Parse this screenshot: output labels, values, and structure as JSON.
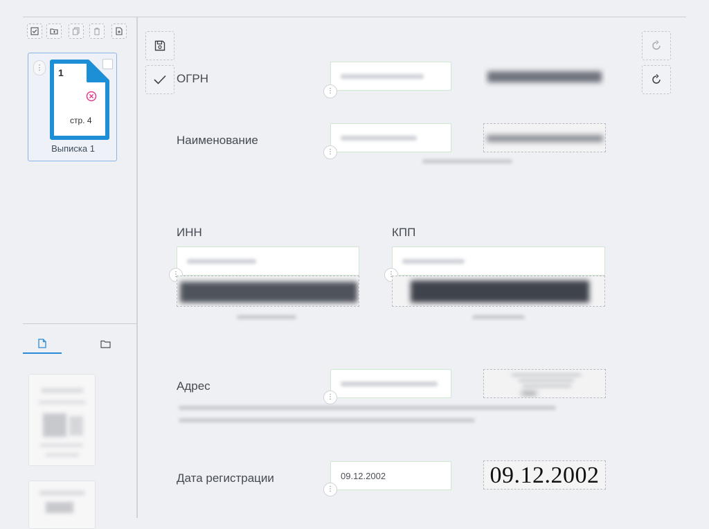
{
  "toolbar": {
    "icons": [
      "check-square-icon",
      "folder-icon",
      "copy-icon",
      "trash-icon",
      "file-add-icon"
    ]
  },
  "document_card": {
    "number": "1",
    "page": "стр. 4",
    "label": "Выписка 1",
    "status_color": "#e53a8c",
    "accent_color": "#1d8fd6"
  },
  "left_tabs": [
    "file-icon",
    "folder-icon"
  ],
  "form": {
    "fields": {
      "ogrn": {
        "label": "ОГРН"
      },
      "name": {
        "label": "Наименование"
      },
      "inn": {
        "label": "ИНН"
      },
      "kpp": {
        "label": "КПП"
      },
      "address": {
        "label": "Адрес"
      },
      "reg_date": {
        "label": "Дата регистрации",
        "value": "09.12.2002",
        "preview_text": "09.12.2002"
      }
    }
  },
  "accent_color": "#2b8ad8"
}
